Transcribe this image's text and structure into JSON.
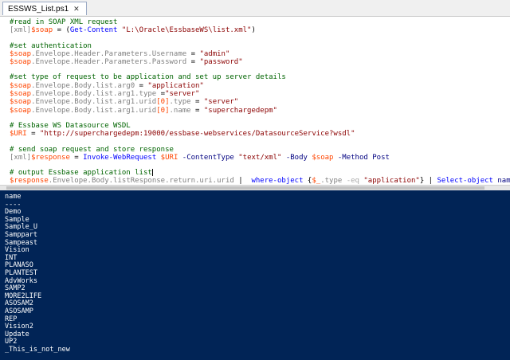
{
  "tab": {
    "title": "ESSWS_List.ps1",
    "close_glyph": "✕"
  },
  "editor": {
    "l1": "#read in SOAP XML request",
    "l2": {
      "type": "[xml]",
      "var": "$soap",
      "eq": " = (",
      "cmd": "Get-Content",
      "str": " \"L:\\Oracle\\EssbaseWS\\list.xml\"",
      "end": ")"
    },
    "l3": "#set authentication",
    "l4": {
      "var": "$soap",
      "path": ".Envelope.Header.Parameters.Username",
      "eq": " = ",
      "str": "\"admin\""
    },
    "l5": {
      "var": "$soap",
      "path": ".Envelope.Header.Parameters.Password",
      "eq": " = ",
      "str": "\"password\""
    },
    "l6": "#set type of request to be application and set up server details",
    "l7": {
      "var": "$soap",
      "path": ".Envelope.Body.list.arg0",
      "eq": " = ",
      "str": "\"application\""
    },
    "l8": {
      "var": "$soap",
      "path": ".Envelope.Body.list.arg1.type",
      "eq": " =",
      "str": "\"server\""
    },
    "l9": {
      "var": "$soap",
      "path": ".Envelope.Body.list.arg1.urid",
      "idx": "[0]",
      "path2": ".type",
      "eq": " = ",
      "str": "\"server\""
    },
    "l10": {
      "var": "$soap",
      "path": ".Envelope.Body.list.arg1.urid",
      "idx": "[0]",
      "path2": ".name",
      "eq": " = ",
      "str": "\"superchargedepm\""
    },
    "l11": "# Essbase WS Datasource WSDL",
    "l12": {
      "var": "$URI",
      "eq": " = ",
      "str": "\"http://superchargedepm:19000/essbase-webservices/DatasourceService?wsdl\""
    },
    "l13": "# send soap request and store response",
    "l14": {
      "type": "[xml]",
      "var": "$response",
      "eq": " = ",
      "cmd": "Invoke-WebRequest",
      "uri": " $URI",
      "p1": " -ContentType",
      "s1": " \"text/xml\"",
      "p2": " -Body",
      "v2": " $soap",
      "p3": " -Method",
      "m": " Post"
    },
    "l15": "# output Essbase application list",
    "l16": {
      "var": "$response",
      "path": ".Envelope.Body.listResponse.return.uri.urid",
      "pipe1": " |  ",
      "cmd1": "where-object",
      "b1": " {",
      "v": "$_",
      "path2": ".type",
      "op": " -eq",
      "str": " \"application\"",
      "b2": "}",
      "pipe2": " | ",
      "cmd2": "Select-object",
      "arg": " name"
    }
  },
  "console_lines": [
    "name",
    "----",
    "Demo",
    "Sample",
    "Sample_U",
    "Samppart",
    "Sampeast",
    "Vision",
    "INT",
    "PLANASO",
    "PLANTEST",
    "AdvWorks",
    "SAMP2",
    "MORE2LIFE",
    "ASOSAM2",
    "ASOSAMP",
    "REP",
    "Vision2",
    "Update",
    "UP2",
    "_This_is_not_new"
  ],
  "colors": {
    "console_bg": "#012456",
    "comment": "#006400",
    "variable": "#ff4500",
    "string": "#8b0000",
    "command": "#0000ff",
    "type": "#808080",
    "parameter": "#000080"
  }
}
